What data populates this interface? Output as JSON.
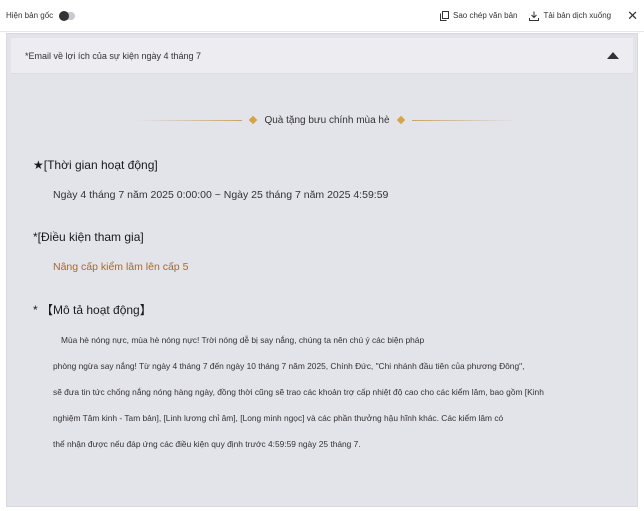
{
  "toolbar": {
    "original_label": "Hiện bản gốc",
    "copy_label": "Sao chép văn bản",
    "download_label": "Tải bản dịch xuống"
  },
  "subject": "*Email về lợi ích của sự kiện ngày 4 tháng 7",
  "banner": "Quà tặng bưu chính mùa hè",
  "sections": {
    "time_title": "★[Thời gian hoạt động]",
    "time_value": "Ngày 4 tháng 7 năm 2025 0:00:00 ~ Ngày 25 tháng 7 năm 2025 4:59:59",
    "condition_title": "*[Điều kiện tham gia]",
    "condition_value": "Nâng cấp kiểm lâm lên cấp 5",
    "desc_title": "* 【Mô tả hoạt động】",
    "desc_lines": [
      "Mùa hè nóng nực, mùa hè nóng nực! Trời nóng dễ bị say nắng, chúng ta nên chú ý các biện pháp",
      "phòng ngừa say nắng! Từ ngày 4 tháng 7 đến ngày 10 tháng 7 năm 2025, Chính Đức, \"Chi nhánh đầu tiên của phương Đông\",",
      "sẽ đưa tin tức chống nắng nóng hàng ngày, đồng thời cũng sẽ trao các khoản trợ cấp nhiệt độ cao cho các kiểm lâm, bao gồm [Kinh",
      "nghiệm Tâm kinh - Tam bản], [Linh lương chỉ âm], [Long minh ngọc] và các phần thưởng hậu hĩnh khác. Các kiểm lâm có",
      "thể nhận được nếu đáp ứng các điều kiện quy định trước 4:59:59 ngày 25 tháng 7."
    ]
  }
}
